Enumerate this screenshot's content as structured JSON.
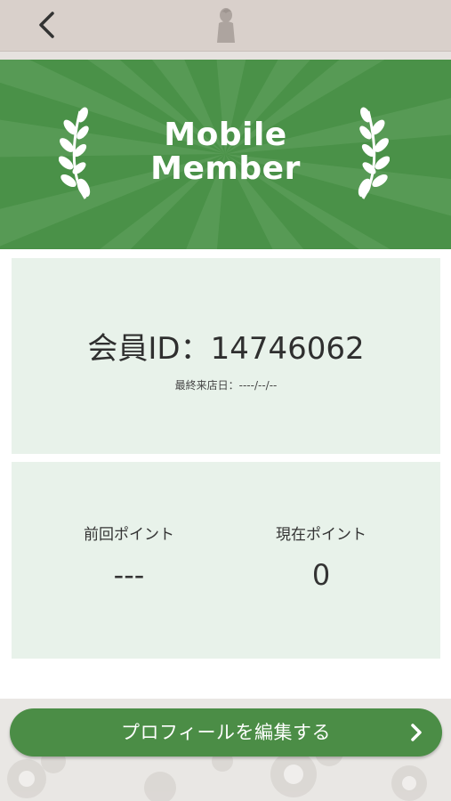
{
  "header": {
    "back_icon": "chevron-left-icon",
    "logo_icon": "logo-figure-icon"
  },
  "banner": {
    "title_line1": "Mobile",
    "title_line2": "Member",
    "color": "#4a9148",
    "left_icon": "laurel-branch-icon",
    "right_icon": "laurel-branch-icon"
  },
  "member_card": {
    "id_label": "会員ID：",
    "id_value": "14746062",
    "last_visit_label": "最終来店日：",
    "last_visit_value": "----/--/--"
  },
  "points_card": {
    "previous_label": "前回ポイント",
    "previous_value": "---",
    "current_label": "現在ポイント",
    "current_value": "0"
  },
  "footer": {
    "edit_profile_label": "プロフィールを編集する",
    "edit_profile_icon": "chevron-right-icon",
    "button_color": "#4b8d46"
  }
}
